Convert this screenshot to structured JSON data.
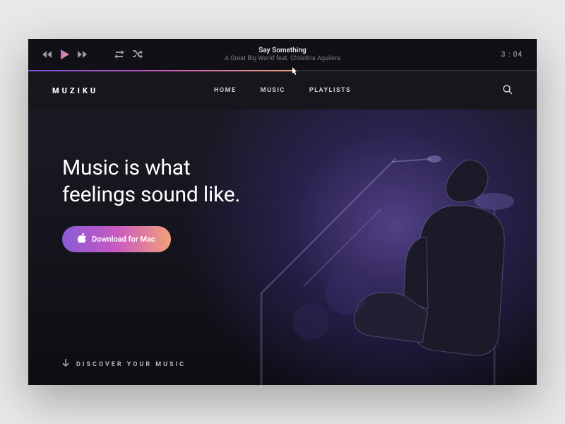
{
  "player": {
    "track_title": "Say Something",
    "track_artist": "A Great Big World feat. Christina Aguilera",
    "time": "3 : 04",
    "progress_pct": 52
  },
  "brand": "MUZIKU",
  "nav": {
    "items": [
      "HOME",
      "MUSIC",
      "PLAYLISTS"
    ]
  },
  "hero": {
    "headline_line1": "Music is what",
    "headline_line2": "feelings sound like.",
    "cta_label": "Download for Mac",
    "discover_label": "DISCOVER YOUR MUSIC"
  },
  "colors": {
    "grad_start": "#8a5bd8",
    "grad_mid": "#c85ac0",
    "grad_end": "#f2a07a"
  }
}
